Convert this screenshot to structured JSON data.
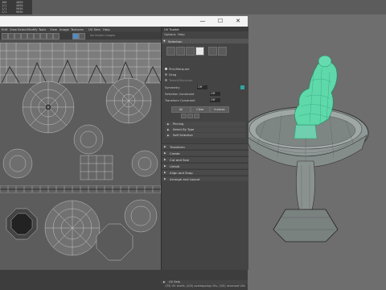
{
  "background": {
    "stats": [
      "160",
      "1/1",
      "1/1",
      "1/1"
    ],
    "stat_values": [
      "4850",
      "4850",
      "9656",
      "9656"
    ],
    "viewport_wire_color": "#3de0b0",
    "model_color": "#9aa3a0"
  },
  "window": {
    "min_icon": "—",
    "max_icon": "☐",
    "close_icon": "✕"
  },
  "menubar": {
    "items": [
      "Edit",
      "View",
      "Select",
      "Modify",
      "Tools",
      "View",
      "Image",
      "Textures",
      "UV Sets",
      "Help"
    ]
  },
  "toolbar": {
    "uv_set_label": "No Visible Images"
  },
  "status": {
    "text": "(33) UV shells, (0/0) overlapping UVs, (0/0) reversed UVs"
  },
  "toolkit": {
    "title": "UV Toolkit",
    "menu": [
      "Options",
      "Help"
    ],
    "selection_header": "Selection",
    "radios": [
      "Pick/Marquee",
      "Drag",
      "Tweak/Marquee"
    ],
    "symmetry_label": "Symmetry",
    "symmetry_value": "Off",
    "selection_constraint_label": "Selection Constraint",
    "selection_constraint_value": "Off",
    "transform_constraint_label": "Transform Constraint",
    "transform_constraint_value": "Off",
    "buttons": [
      "All",
      "Clear",
      "Inverse"
    ],
    "sub_sections": [
      "Pinning",
      "Select By Type",
      "Soft Selection"
    ],
    "sections": [
      "Transform",
      "Create",
      "Cut and Sew",
      "Unfold",
      "Align and Snap",
      "Arrange and Layout"
    ],
    "footer": "UV Sets",
    "accent_color": "#2fa6a0"
  }
}
